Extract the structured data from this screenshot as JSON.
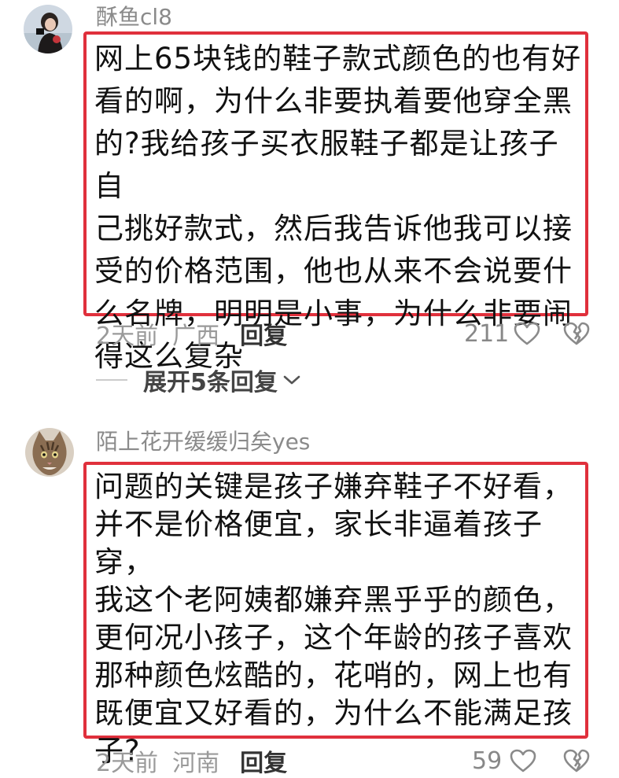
{
  "comments": [
    {
      "username": "酥鱼cl8",
      "avatar_icon": "user-photo-avatar",
      "text": "网上65块钱的鞋子款式颜色的也有好\n看的啊，为什么非要执着要他穿全黑\n的?我给孩子买衣服鞋子都是让孩子自\n己挑好款式，然后我告诉他我可以接\n受的价格范围，他也从来不会说要什\n么名牌，明明是小事，为什么非要闹\n得这么复杂",
      "time": "2天前",
      "location": "广西",
      "reply_label": "回复",
      "like_count": "211",
      "expand_label": "展开5条回复"
    },
    {
      "username": "陌上花开缓缓归矣yes",
      "avatar_icon": "cat-photo-avatar",
      "text": "问题的关键是孩子嫌弃鞋子不好看，\n并不是价格便宜，家长非逼着孩子穿，\n我这个老阿姨都嫌弃黑乎乎的颜色，\n更何况小孩子，这个年龄的孩子喜欢\n那种颜色炫酷的，花哨的，网上也有\n既便宜又好看的，为什么不能满足孩\n子?",
      "time": "2天前",
      "location": "河南",
      "reply_label": "回复",
      "like_count": "59"
    }
  ],
  "colors": {
    "highlight_border": "#e0303c",
    "meta_text": "#9a9a9a",
    "username": "#8a8a8a"
  }
}
